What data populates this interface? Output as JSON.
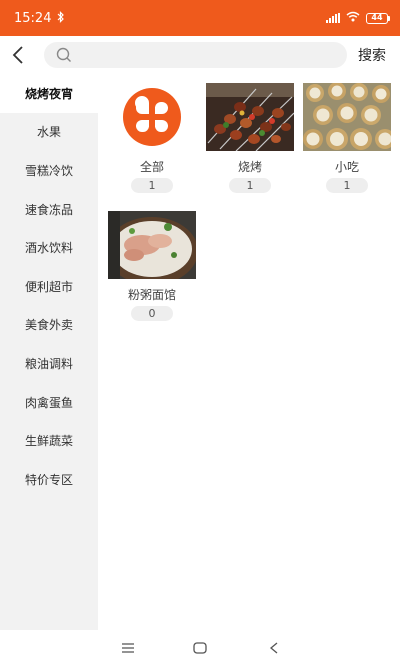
{
  "status": {
    "time": "15:24",
    "battery": "44"
  },
  "search": {
    "placeholder": "",
    "button_label": "搜索"
  },
  "sidebar": {
    "items": [
      {
        "label": "烧烤夜宵",
        "active": true
      },
      {
        "label": "水果"
      },
      {
        "label": "雪糕冷饮"
      },
      {
        "label": "速食冻品"
      },
      {
        "label": "酒水饮料"
      },
      {
        "label": "便利超市"
      },
      {
        "label": "美食外卖"
      },
      {
        "label": "粮油调料"
      },
      {
        "label": "肉禽蛋鱼"
      },
      {
        "label": "生鲜蔬菜"
      },
      {
        "label": "特价专区"
      }
    ]
  },
  "categories": [
    {
      "name": "全部",
      "count": "1",
      "icon": "all-categories-icon"
    },
    {
      "name": "烧烤",
      "count": "1",
      "icon": "barbecue-photo"
    },
    {
      "name": "小吃",
      "count": "1",
      "icon": "snacks-photo"
    },
    {
      "name": "粉粥面馆",
      "count": "0",
      "icon": "noodle-porridge-photo"
    }
  ],
  "colors": {
    "brand": "#ef5a1c",
    "sidebar_bg": "#f2f2f2"
  }
}
